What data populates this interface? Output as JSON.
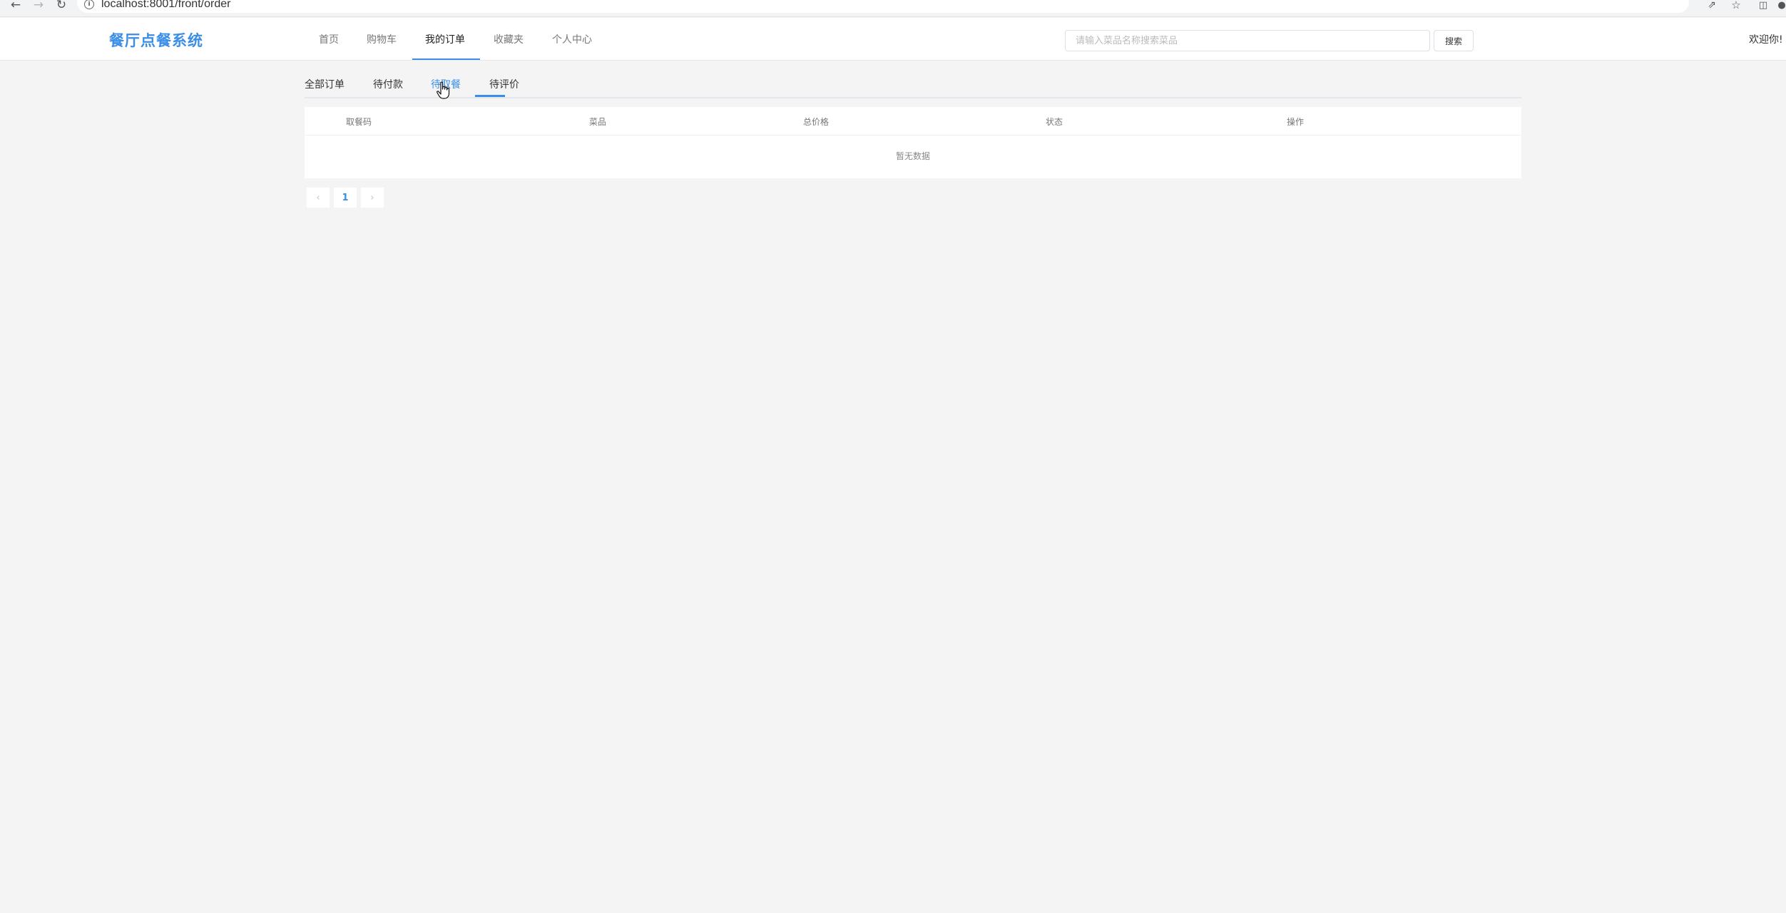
{
  "browser": {
    "url": "localhost:8001/front/order"
  },
  "header": {
    "logo": "餐厅点餐系统",
    "nav": [
      "首页",
      "购物车",
      "我的订单",
      "收藏夹",
      "个人中心"
    ],
    "active_nav": "我的订单",
    "search_placeholder": "请输入菜品名称搜索菜品",
    "search_button": "搜索",
    "welcome": "欢迎你!"
  },
  "order_tabs": [
    "全部订单",
    "待付款",
    "待取餐",
    "待评价"
  ],
  "active_tab": "待取餐",
  "table": {
    "columns": [
      "取餐码",
      "菜品",
      "总价格",
      "状态",
      "操作"
    ],
    "empty_text": "暂无数据"
  },
  "pagination": {
    "current_page": "1"
  },
  "colors": {
    "accent": "#3a8ee6",
    "background": "#f4f4f4"
  },
  "icons": [
    "back-arrow-icon",
    "forward-arrow-icon",
    "reload-icon",
    "info-icon",
    "share-icon",
    "star-icon",
    "sidebar-icon",
    "profile-icon",
    "chevron-left-icon",
    "chevron-right-icon",
    "hand-cursor-icon"
  ]
}
